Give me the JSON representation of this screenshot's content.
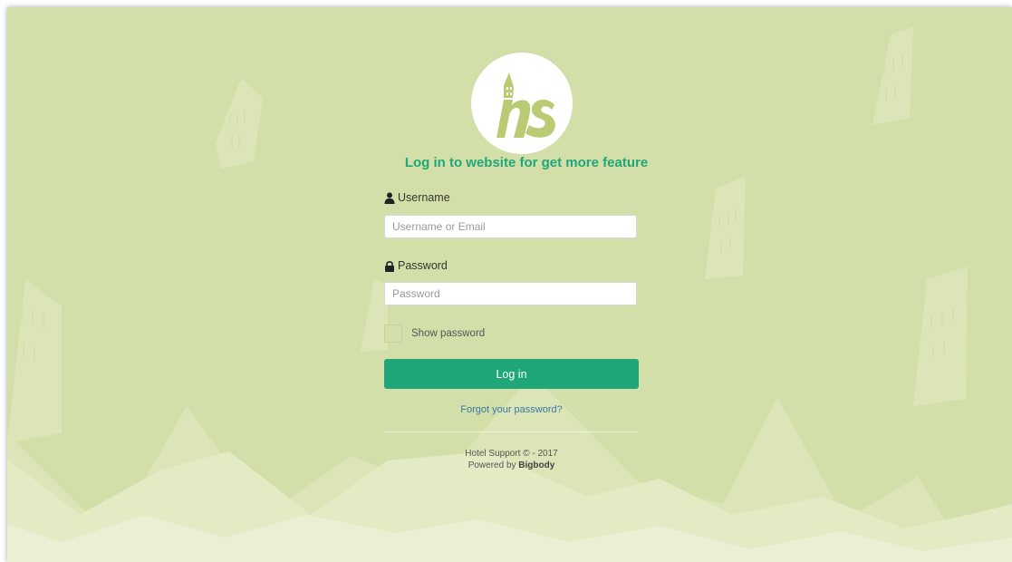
{
  "login": {
    "heading": "Log in to website for get more feature",
    "username_label": "Username",
    "username_placeholder": "Username or Email",
    "password_label": "Password",
    "password_placeholder": "Password",
    "show_password_label": "Show password",
    "login_button": "Log in",
    "forgot_link": "Forgot your password?"
  },
  "footer": {
    "copyright": "Hotel Support © - 2017",
    "powered_prefix": "Powered by",
    "powered_brand": "Bigbody"
  },
  "icons": {
    "logo": "ns-logo",
    "username": "user-icon",
    "password": "lock-icon"
  },
  "colors": {
    "accent": "#1fa77a",
    "background": "#d3dfa9",
    "link": "#3b78a8"
  }
}
